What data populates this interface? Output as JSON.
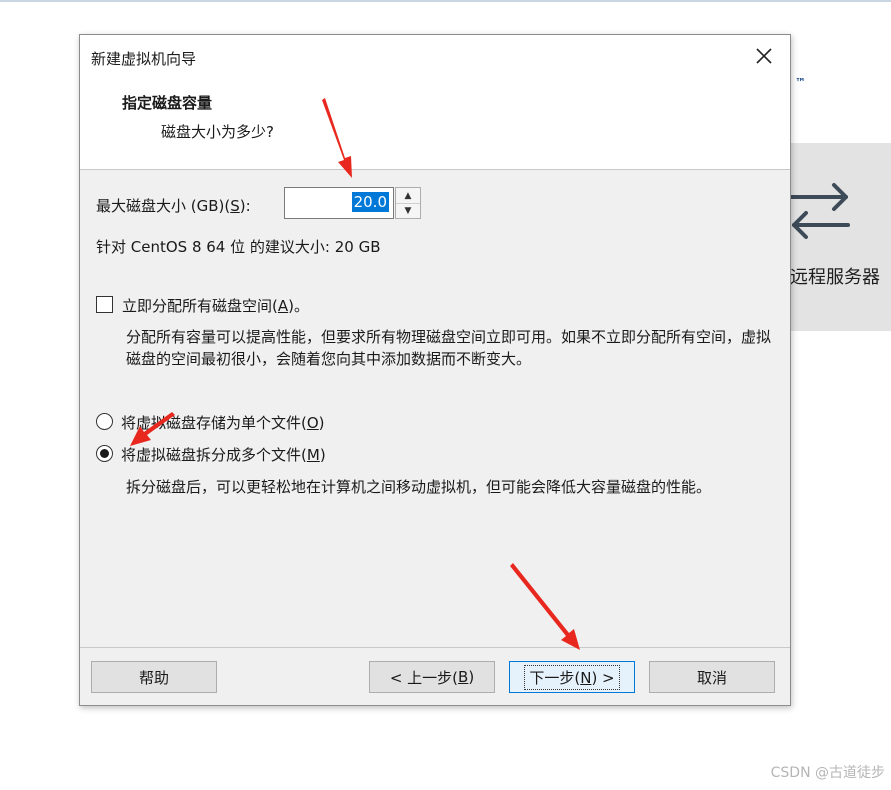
{
  "background": {
    "trademark": "™",
    "remote_server_label": "远程服务器"
  },
  "dialog": {
    "window_title": "新建虚拟机向导",
    "header_title": "指定磁盘容量",
    "header_subtitle": "磁盘大小为多少?",
    "max_size_label": "最大磁盘大小 (GB)(",
    "max_size_accel": "S",
    "max_size_suffix": "):",
    "max_size_value": "20.0",
    "recommended_text": "针对 CentOS 8 64 位 的建议大小: 20 GB",
    "allocate_label": "立即分配所有磁盘空间(",
    "allocate_accel": "A",
    "allocate_suffix": ")。",
    "allocate_checked": false,
    "allocate_desc": "分配所有容量可以提高性能，但要求所有物理磁盘空间立即可用。如果不立即分配所有空间，虚拟磁盘的空间最初很小，会随着您向其中添加数据而不断变大。",
    "single_file_label": "将虚拟磁盘存储为单个文件(",
    "single_file_accel": "O",
    "single_file_suffix": ")",
    "multi_file_label": "将虚拟磁盘拆分成多个文件(",
    "multi_file_accel": "M",
    "multi_file_suffix": ")",
    "selected_option": "multi_file",
    "multi_file_desc": "拆分磁盘后，可以更轻松地在计算机之间移动虚拟机，但可能会降低大容量磁盘的性能。",
    "buttons": {
      "help": "帮助",
      "back_prefix": "< 上一步(",
      "back_accel": "B",
      "back_suffix": ")",
      "next_prefix": "下一步(",
      "next_accel": "N",
      "next_suffix": ") >",
      "cancel": "取消"
    }
  },
  "watermark": "CSDN @古道徒步",
  "colors": {
    "selection": "#0078d7",
    "annotation_arrow": "#e8281e",
    "dialog_bg": "#f0f0f0"
  }
}
